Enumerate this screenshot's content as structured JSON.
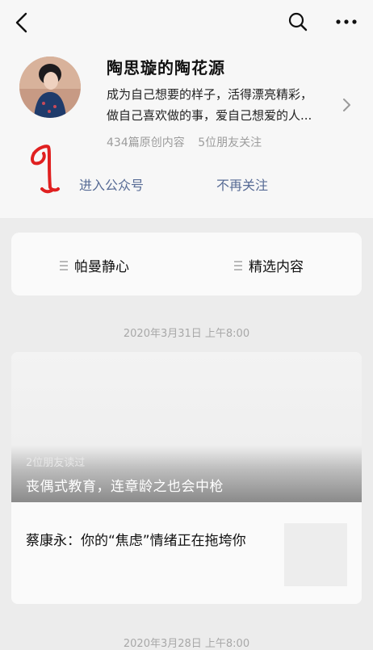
{
  "account": {
    "name": "陶思璇的陶花源",
    "bio_line1": "成为自己想要的样子，活得漂亮精彩，",
    "bio_line2": "做自己喜欢做的事，爱自己想爱的人...",
    "original_count": "434篇原创内容",
    "friends_following": "5位朋友关注"
  },
  "actions": {
    "enter": "进入公众号",
    "unfollow": "不再关注"
  },
  "menu": [
    {
      "label": "帕曼静心"
    },
    {
      "label": "精选内容"
    }
  ],
  "feed": {
    "timestamp1": "2020年3月31日 上午8:00",
    "friends_read": "2位朋友读过",
    "cover_title": "丧偶式教育，连章龄之也会中枪",
    "second_title": "蔡康永：你的“焦虑”情绪正在拖垮你",
    "timestamp2": "2020年3月28日 上午8:00"
  },
  "colors": {
    "link": "#576b95",
    "annotation": "#e02020"
  },
  "annotation_text": "1"
}
